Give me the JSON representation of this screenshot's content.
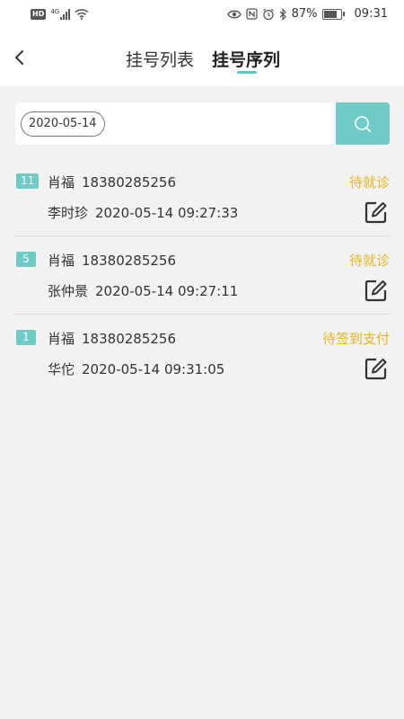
{
  "status_bar": {
    "hd_label": "HD",
    "network_label": "4G",
    "battery_text": "87%",
    "battery_level": 0.87,
    "time": "09:31"
  },
  "header": {
    "tabs": [
      {
        "label": "挂号列表",
        "active": false
      },
      {
        "label": "挂号序列",
        "active": true
      }
    ],
    "accent_color": "#5bc9c1"
  },
  "search": {
    "date_value": "2020-05-14"
  },
  "records": [
    {
      "number": "11",
      "patient_name": "肖福",
      "phone": "18380285256",
      "status": "待就诊",
      "doctor": "李时珍",
      "time": "2020-05-14 09:27:33"
    },
    {
      "number": "5",
      "patient_name": "肖福",
      "phone": "18380285256",
      "status": "待就诊",
      "doctor": "张仲景",
      "time": "2020-05-14 09:27:11"
    },
    {
      "number": "1",
      "patient_name": "肖福",
      "phone": "18380285256",
      "status": "待签到支付",
      "doctor": "华佗",
      "time": "2020-05-14 09:31:05"
    }
  ],
  "colors": {
    "status": "#e9b31d",
    "badge": "#6ecbc5"
  }
}
